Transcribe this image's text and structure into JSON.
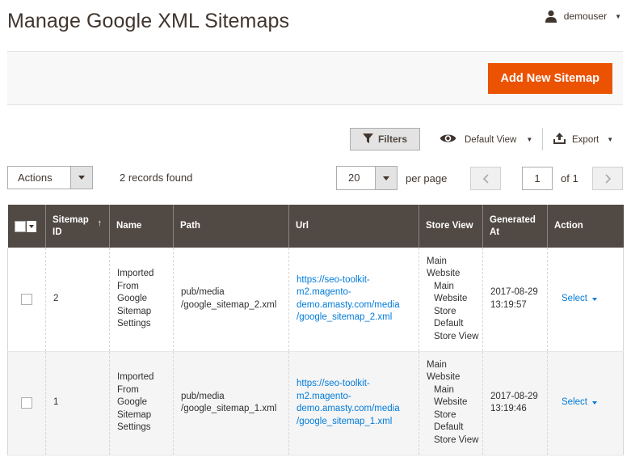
{
  "header": {
    "title": "Manage Google XML Sitemaps",
    "user": "demouser"
  },
  "action_bar": {
    "add_button": "Add New Sitemap"
  },
  "toolbar": {
    "filters": "Filters",
    "view": "Default View",
    "export": "Export",
    "actions": "Actions",
    "records_found": "2 records found",
    "per_page_value": "20",
    "per_page_label": "per page",
    "current_page": "1",
    "of_pages": "of 1"
  },
  "grid": {
    "columns": [
      {
        "label": ""
      },
      {
        "label": "Sitemap ID"
      },
      {
        "label": "Name"
      },
      {
        "label": "Path"
      },
      {
        "label": "Url"
      },
      {
        "label": "Store View"
      },
      {
        "label": "Generated At"
      },
      {
        "label": "Action"
      }
    ],
    "rows": [
      {
        "id": "2",
        "name": "Imported From Google Sitemap Settings",
        "path": "pub/media /google_sitemap_2.xml",
        "url": "https://seo-toolkit-m2.magento-demo.amasty.com/media /google_sitemap_2.xml",
        "store_view": {
          "line1": "Main Website",
          "line2": "Main Website Store",
          "line3": "Default Store View"
        },
        "generated_at": "2017-08-29 13:19:57",
        "action": "Select"
      },
      {
        "id": "1",
        "name": "Imported From Google Sitemap Settings",
        "path": "pub/media /google_sitemap_1.xml",
        "url": "https://seo-toolkit-m2.magento-demo.amasty.com/media /google_sitemap_1.xml",
        "store_view": {
          "line1": "Main Website",
          "line2": "Main Website Store",
          "line3": "Default Store View"
        },
        "generated_at": "2017-08-29 13:19:46",
        "action": "Select"
      }
    ]
  },
  "colors": {
    "accent": "#eb5202",
    "header_bg": "#514943",
    "link": "#007bdb"
  },
  "icons": {
    "user": "user-icon",
    "filter": "funnel-icon",
    "view": "eye-icon",
    "export": "upload-icon"
  }
}
